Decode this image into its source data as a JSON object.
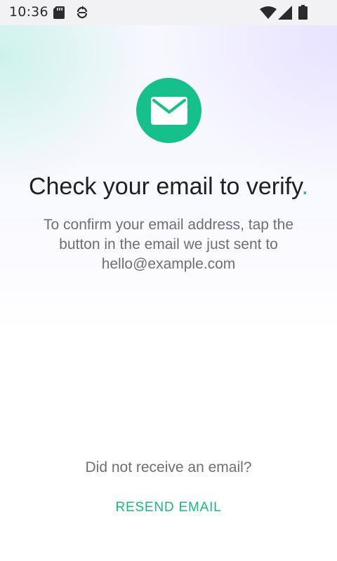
{
  "status_bar": {
    "time": "10:36",
    "icons": [
      "sd-card-icon",
      "sync-icon",
      "wifi-icon",
      "cell-signal-icon",
      "battery-icon"
    ]
  },
  "colors": {
    "accent": "#16c08a",
    "title_text": "#1f1f24",
    "body_text": "#6e6e73",
    "status_bar_bg": "#f2f2f4"
  },
  "main": {
    "icon": "mail-icon",
    "title": "Check your email to verify",
    "title_dot": ".",
    "subtitle": "To confirm your email address, tap the button in the email we just sent to hello@example.com"
  },
  "footer": {
    "prompt": "Did not receive an email?",
    "resend_label": "RESEND EMAIL"
  }
}
